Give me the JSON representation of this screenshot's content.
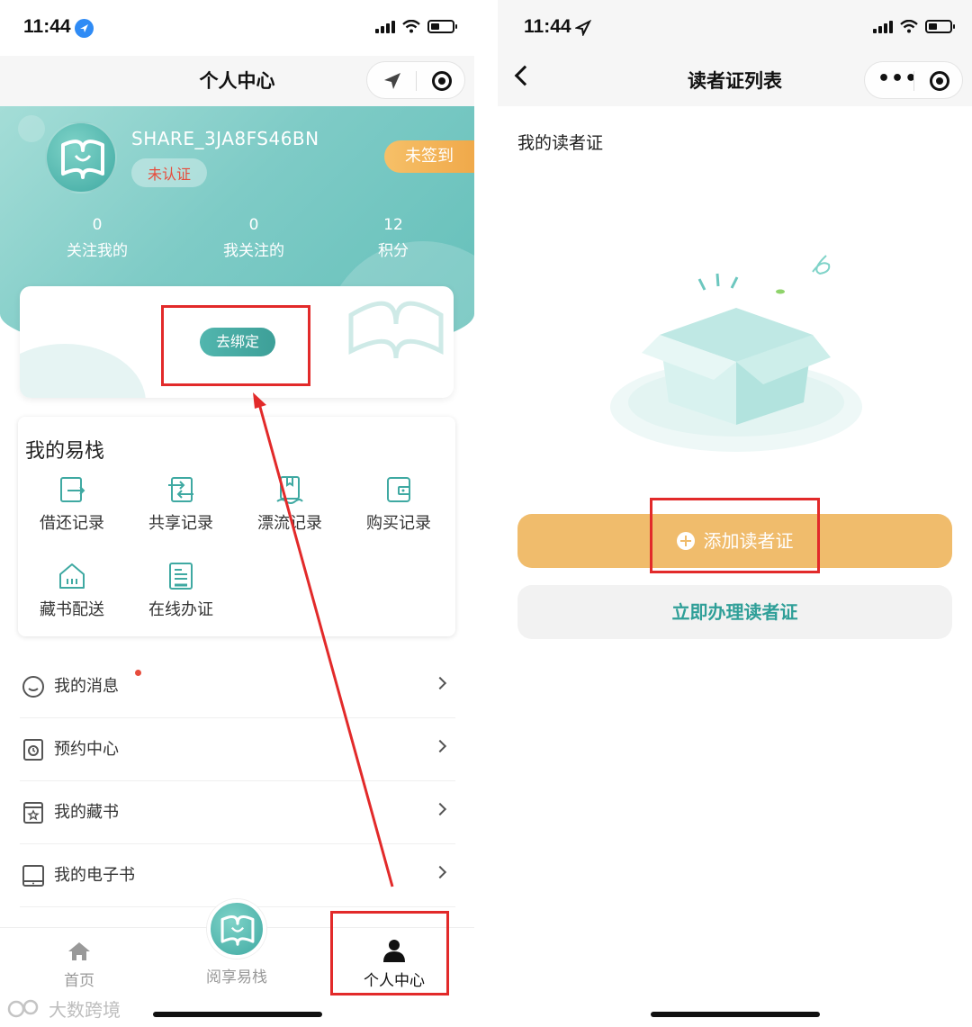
{
  "left": {
    "status": {
      "time": "11:44"
    },
    "nav": {
      "title": "个人中心"
    },
    "profile": {
      "username": "SHARE_3JA8FS46BN",
      "verify_status": "未认证",
      "signin_label": "未签到",
      "stats": [
        {
          "value": "0",
          "label": "关注我的"
        },
        {
          "value": "0",
          "label": "我关注的"
        },
        {
          "value": "12",
          "label": "积分"
        }
      ]
    },
    "bind": {
      "button_label": "去绑定"
    },
    "yizhan": {
      "title": "我的易栈",
      "items": [
        {
          "label": "借还记录",
          "icon": "borrow-return-icon"
        },
        {
          "label": "共享记录",
          "icon": "share-record-icon"
        },
        {
          "label": "漂流记录",
          "icon": "drift-record-icon"
        },
        {
          "label": "购买记录",
          "icon": "purchase-record-icon"
        },
        {
          "label": "藏书配送",
          "icon": "delivery-icon"
        },
        {
          "label": "在线办证",
          "icon": "online-card-icon"
        }
      ]
    },
    "menu": [
      {
        "label": "我的消息",
        "icon": "message-icon"
      },
      {
        "label": "预约中心",
        "icon": "reservation-icon"
      },
      {
        "label": "我的藏书",
        "icon": "collection-icon"
      },
      {
        "label": "我的电子书",
        "icon": "ebook-icon"
      }
    ],
    "tabbar": [
      {
        "label": "首页",
        "icon": "home-icon"
      },
      {
        "label": "阅享易栈",
        "icon": "book-logo-icon"
      },
      {
        "label": "个人中心",
        "icon": "person-icon"
      }
    ],
    "watermark": "大数跨境"
  },
  "right": {
    "status": {
      "time": "11:44"
    },
    "nav": {
      "title": "读者证列表"
    },
    "section_label": "我的读者证",
    "add_button": "添加读者证",
    "apply_button": "立即办理读者证"
  },
  "colors": {
    "teal": "#63bfb9",
    "orange": "#f0bc6c",
    "annotation_red": "#e22a2a"
  }
}
